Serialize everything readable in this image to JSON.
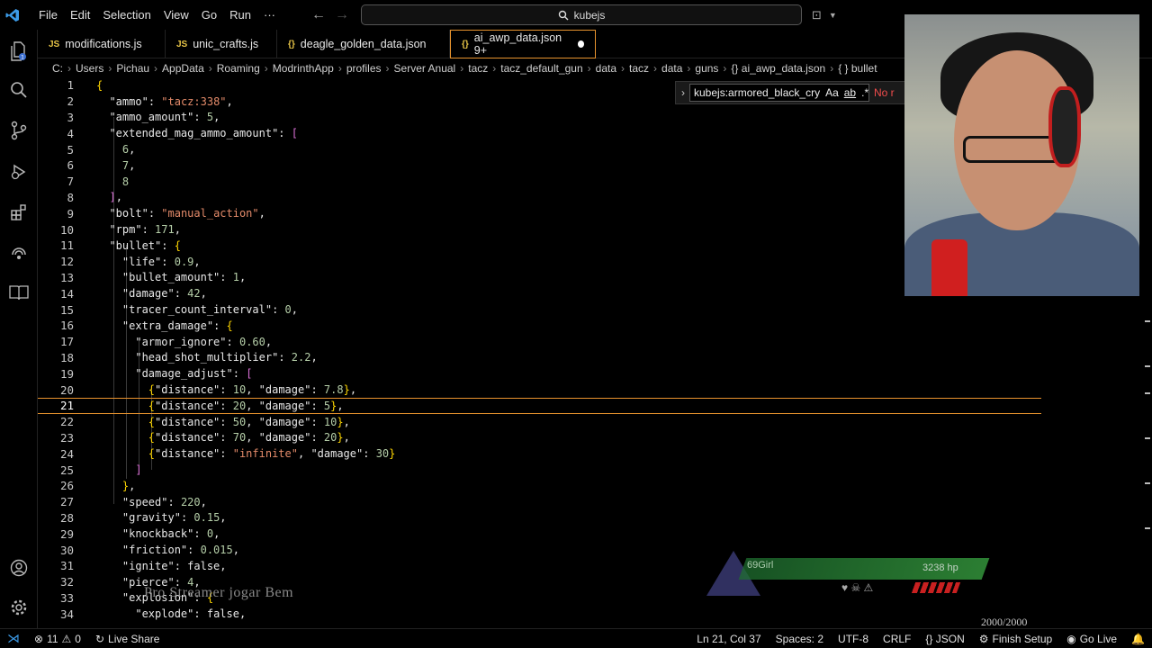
{
  "menu": [
    "File",
    "Edit",
    "Selection",
    "View",
    "Go",
    "Run",
    "···"
  ],
  "search": {
    "text": "kubejs"
  },
  "tabs": [
    {
      "label": "modifications.js",
      "icon": "JS"
    },
    {
      "label": "unic_crafts.js",
      "icon": "JS"
    },
    {
      "label": "deagle_golden_data.json",
      "icon": "{}"
    },
    {
      "label": "ai_awp_data.json 9+",
      "icon": "{}"
    }
  ],
  "breadcrumbs": [
    "C:",
    "Users",
    "Pichau",
    "AppData",
    "Roaming",
    "ModrinthApp",
    "profiles",
    "Server Anual",
    "tacz",
    "tacz_default_gun",
    "data",
    "tacz",
    "data",
    "guns",
    "{} ai_awp_data.json",
    "{ } bullet"
  ],
  "find": {
    "value": "kubejs:armored_black_cry",
    "case_label": "Aa",
    "word_label": "ab",
    "regex_label": ".*",
    "result": "No r"
  },
  "code_lines": [
    "{",
    "  \"ammo\": \"tacz:338\",",
    "  \"ammo_amount\": 5,",
    "  \"extended_mag_ammo_amount\": [",
    "    6,",
    "    7,",
    "    8",
    "  ],",
    "  \"bolt\": \"manual_action\",",
    "  \"rpm\": 171,",
    "  \"bullet\": {",
    "    \"life\": 0.9,",
    "    \"bullet_amount\": 1,",
    "    \"damage\": 42,",
    "    \"tracer_count_interval\": 0,",
    "    \"extra_damage\": {",
    "      \"armor_ignore\": 0.60,",
    "      \"head_shot_multiplier\": 2.2,",
    "      \"damage_adjust\": [",
    "        {\"distance\": 10, \"damage\": 7.8},",
    "        {\"distance\": 20, \"damage\": 5},",
    "        {\"distance\": 50, \"damage\": 10},",
    "        {\"distance\": 70, \"damage\": 20},",
    "        {\"distance\": \"infinite\", \"damage\": 30}",
    "      ]",
    "    },",
    "    \"speed\": 220,",
    "    \"gravity\": 0.15,",
    "    \"knockback\": 0,",
    "    \"friction\": 0.015,",
    "    \"ignite\": false,",
    "    \"pierce\": 4,",
    "    \"explosion\": {",
    "      \"explode\": false,"
  ],
  "current_line": 21,
  "hud": {
    "player_name": "69Girl",
    "hp_text": "3238 hp",
    "score": "2000/2000"
  },
  "watermark": "Pro Streamer jogar Bem",
  "status": {
    "errors": "11",
    "warnings": "0",
    "live_share": "Live Share",
    "position": "Ln 21, Col 37",
    "spaces": "Spaces: 2",
    "encoding": "UTF-8",
    "eol": "CRLF",
    "language": "{} JSON",
    "finish_setup": "Finish Setup",
    "go_live": "Go Live"
  },
  "colors": {
    "accent": "#e8932e",
    "string": "#e48b6a",
    "number": "#b5cea8",
    "keyword": "#569cd6"
  }
}
